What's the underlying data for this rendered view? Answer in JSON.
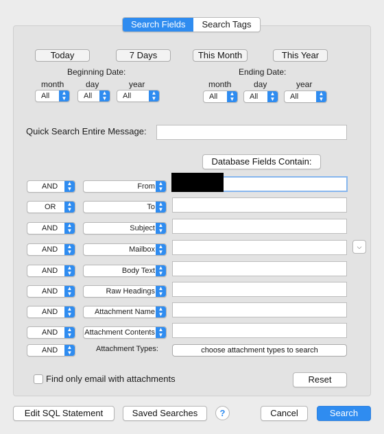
{
  "tabs": [
    {
      "label": "Search Fields",
      "active": true
    },
    {
      "label": "Search Tags",
      "active": false
    }
  ],
  "quick_dates": [
    "Today",
    "7 Days",
    "This Month",
    "This Year"
  ],
  "beginning_date": {
    "label": "Beginning Date:",
    "month_label": "month",
    "day_label": "day",
    "year_label": "year",
    "month": "All",
    "day": "All",
    "year": "All"
  },
  "ending_date": {
    "label": "Ending Date:",
    "month_label": "month",
    "day_label": "day",
    "year_label": "year",
    "month": "All",
    "day": "All",
    "year": "All"
  },
  "quick_search": {
    "label": "Quick Search Entire Message:",
    "value": ""
  },
  "db_fields_header": "Database Fields Contain:",
  "rows": [
    {
      "op": "AND",
      "field": "From",
      "value": ""
    },
    {
      "op": "OR",
      "field": "To",
      "value": ""
    },
    {
      "op": "AND",
      "field": "Subject",
      "value": ""
    },
    {
      "op": "AND",
      "field": "Mailbox",
      "value": ""
    },
    {
      "op": "AND",
      "field": "Body Text",
      "value": ""
    },
    {
      "op": "AND",
      "field": "Raw Headings",
      "value": ""
    },
    {
      "op": "AND",
      "field": "Attachment Name",
      "value": ""
    },
    {
      "op": "AND",
      "field": "Attachment Contents",
      "value": ""
    },
    {
      "op": "AND"
    }
  ],
  "attachment_types": {
    "label": "Attachment Types:",
    "button": "choose attachment types to search"
  },
  "only_attachments": {
    "label": "Find only email with attachments",
    "checked": false
  },
  "reset": "Reset",
  "footer": {
    "edit_sql": "Edit SQL Statement",
    "saved_searches": "Saved Searches",
    "help": "?",
    "cancel": "Cancel",
    "search": "Search"
  },
  "colors": {
    "accent": "#2f8cf0",
    "background": "#ececec",
    "panel": "#e3e3e3"
  }
}
